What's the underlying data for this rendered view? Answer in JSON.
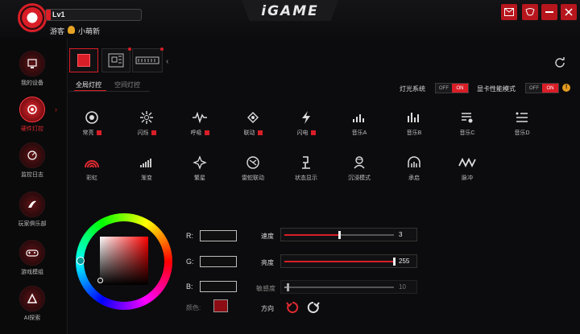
{
  "app": {
    "title": "iGAME"
  },
  "user": {
    "level": "Lv1",
    "guest": "游客",
    "nickname": "小萌新"
  },
  "window_buttons": [
    "mail-icon",
    "skin-icon",
    "minimize-icon",
    "close-icon"
  ],
  "sidebar": {
    "items": [
      {
        "label": "我的设备",
        "icon": "device-icon",
        "active": false
      },
      {
        "label": "硬件灯控",
        "icon": "light-control-icon",
        "active": true
      },
      {
        "label": "监控日志",
        "icon": "monitor-log-icon",
        "active": false
      },
      {
        "label": "玩家俱乐部",
        "icon": "club-icon",
        "active": false
      },
      {
        "label": "游戏模组",
        "icon": "game-mod-icon",
        "active": false
      },
      {
        "label": "AI探索",
        "icon": "ai-explore-icon",
        "active": false
      }
    ]
  },
  "devices": [
    {
      "name": "gpu-device",
      "active": true
    },
    {
      "name": "motherboard-device",
      "active": false
    },
    {
      "name": "memory-device",
      "active": false
    }
  ],
  "mode_tabs": [
    {
      "label": "全局灯控",
      "active": true
    },
    {
      "label": "空间灯控",
      "active": false
    }
  ],
  "toggles": {
    "light_system": {
      "label": "灯光系统",
      "off": "OFF",
      "on": "ON",
      "state": "on"
    },
    "gpu_perf": {
      "label": "显卡性能模式",
      "off": "OFF",
      "on": "ON",
      "state": "on"
    }
  },
  "effects": [
    {
      "label": "常亮",
      "icon": "static-icon",
      "flag": true
    },
    {
      "label": "闪烁",
      "icon": "blink-icon",
      "flag": true
    },
    {
      "label": "呼吸",
      "icon": "breath-icon",
      "flag": true
    },
    {
      "label": "联动",
      "icon": "sync-icon",
      "flag": true
    },
    {
      "label": "闪电",
      "icon": "lightning-icon",
      "flag": true
    },
    {
      "label": "音乐A",
      "icon": "music-a-icon",
      "flag": false
    },
    {
      "label": "音乐B",
      "icon": "music-b-icon",
      "flag": false
    },
    {
      "label": "音乐C",
      "icon": "music-c-icon",
      "flag": false
    },
    {
      "label": "音乐D",
      "icon": "music-d-icon",
      "flag": false
    },
    {
      "label": "彩虹",
      "icon": "rainbow-icon",
      "flag": false
    },
    {
      "label": "渐变",
      "icon": "gradient-icon",
      "flag": false
    },
    {
      "label": "繁星",
      "icon": "stars-icon",
      "flag": false
    },
    {
      "label": "雷蛇联动",
      "icon": "razer-sync-icon",
      "flag": false
    },
    {
      "label": "状态显示",
      "icon": "status-display-icon",
      "flag": false
    },
    {
      "label": "沉浸模式",
      "icon": "immersive-icon",
      "flag": false
    },
    {
      "label": "承启",
      "icon": "chengqi-icon",
      "flag": false
    },
    {
      "label": "脉冲",
      "icon": "pulse-icon",
      "flag": false
    }
  ],
  "color": {
    "r_label": "R:",
    "g_label": "G:",
    "b_label": "B:",
    "r": "",
    "g": "",
    "b": "",
    "color_label": "颜色:",
    "swatch": "#8b0c12"
  },
  "sliders": {
    "speed": {
      "label": "速度",
      "value": "3",
      "fraction": 0.5
    },
    "brightness": {
      "label": "亮度",
      "value": "255",
      "fraction": 1.0
    },
    "sensitivity": {
      "label": "敏感度",
      "value": "10",
      "fraction": 0.03
    }
  },
  "direction": {
    "label": "方向"
  },
  "colors": {
    "accent": "#d91e27",
    "background": "#0c0c0e"
  }
}
